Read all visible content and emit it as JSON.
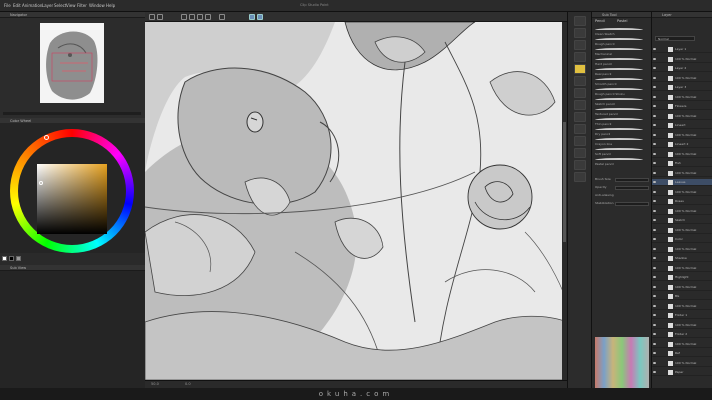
{
  "menu": {
    "items": [
      "File",
      "Edit",
      "Animation",
      "Layer",
      "Select",
      "View",
      "Filter",
      "Window",
      "Help"
    ],
    "window_title": "Clip Studio Paint"
  },
  "left_panels": {
    "navigator_title": "Navigator",
    "color_title": "Color Wheel",
    "sub_title": "Sub View"
  },
  "color": {
    "main_color": "#e6a11f",
    "swatches": [
      "#ffffff",
      "#000000",
      "#9a9a9a"
    ]
  },
  "toolbar": {
    "icons": [
      "new-icon",
      "open-icon",
      "save-icon",
      "undo-icon",
      "redo-icon",
      "clear-icon",
      "transform-icon",
      "snap-icon",
      "ruler-icon"
    ]
  },
  "brush_panel": {
    "title": "Sub Tool",
    "tabs": [
      "Pencil",
      "Pastel"
    ],
    "brushes": [
      "Clean Sketch",
      "Rough pencil",
      "Mechanical",
      "Hard pencil",
      "Real pencil",
      "Smooth pencil",
      "Rough pencil Shoku",
      "Sketch pencil",
      "Textured pencil",
      "Thin pencil",
      "Dry pencil",
      "Crayon line",
      "Soft pencil",
      "Pastel pencil"
    ],
    "properties": [
      {
        "label": "Brush Size",
        "value": "0.6"
      },
      {
        "label": "Opacity",
        "value": "100"
      },
      {
        "label": "Anti-aliasing",
        "value": ""
      },
      {
        "label": "Stabilization",
        "value": "15"
      }
    ]
  },
  "layers": {
    "title": "Layer",
    "blend_mode": "Normal",
    "opacity": "100",
    "items": [
      "Layer 1",
      "100 % Normal",
      "Layer 2",
      "100 % Normal",
      "Layer 3",
      "100 % Normal",
      "Flowers",
      "100 % Normal",
      "Lineart",
      "100 % Normal",
      "Lineart 2",
      "100 % Normal",
      "Fish",
      "100 % Normal",
      "Leaves",
      "100 % Normal",
      "Roses",
      "100 % Normal",
      "Sketch",
      "100 % Normal",
      "Color",
      "100 % Normal",
      "Shadow",
      "100 % Normal",
      "Highlight",
      "100 % Normal",
      "BG",
      "100 % Normal",
      "Folder 1",
      "100 % Normal",
      "Folder 2",
      "100 % Normal",
      "Ref",
      "100 % Normal",
      "Paper"
    ]
  },
  "status": {
    "zoom": "50.0",
    "angle": "0.0"
  },
  "watermark": "okuha.com"
}
